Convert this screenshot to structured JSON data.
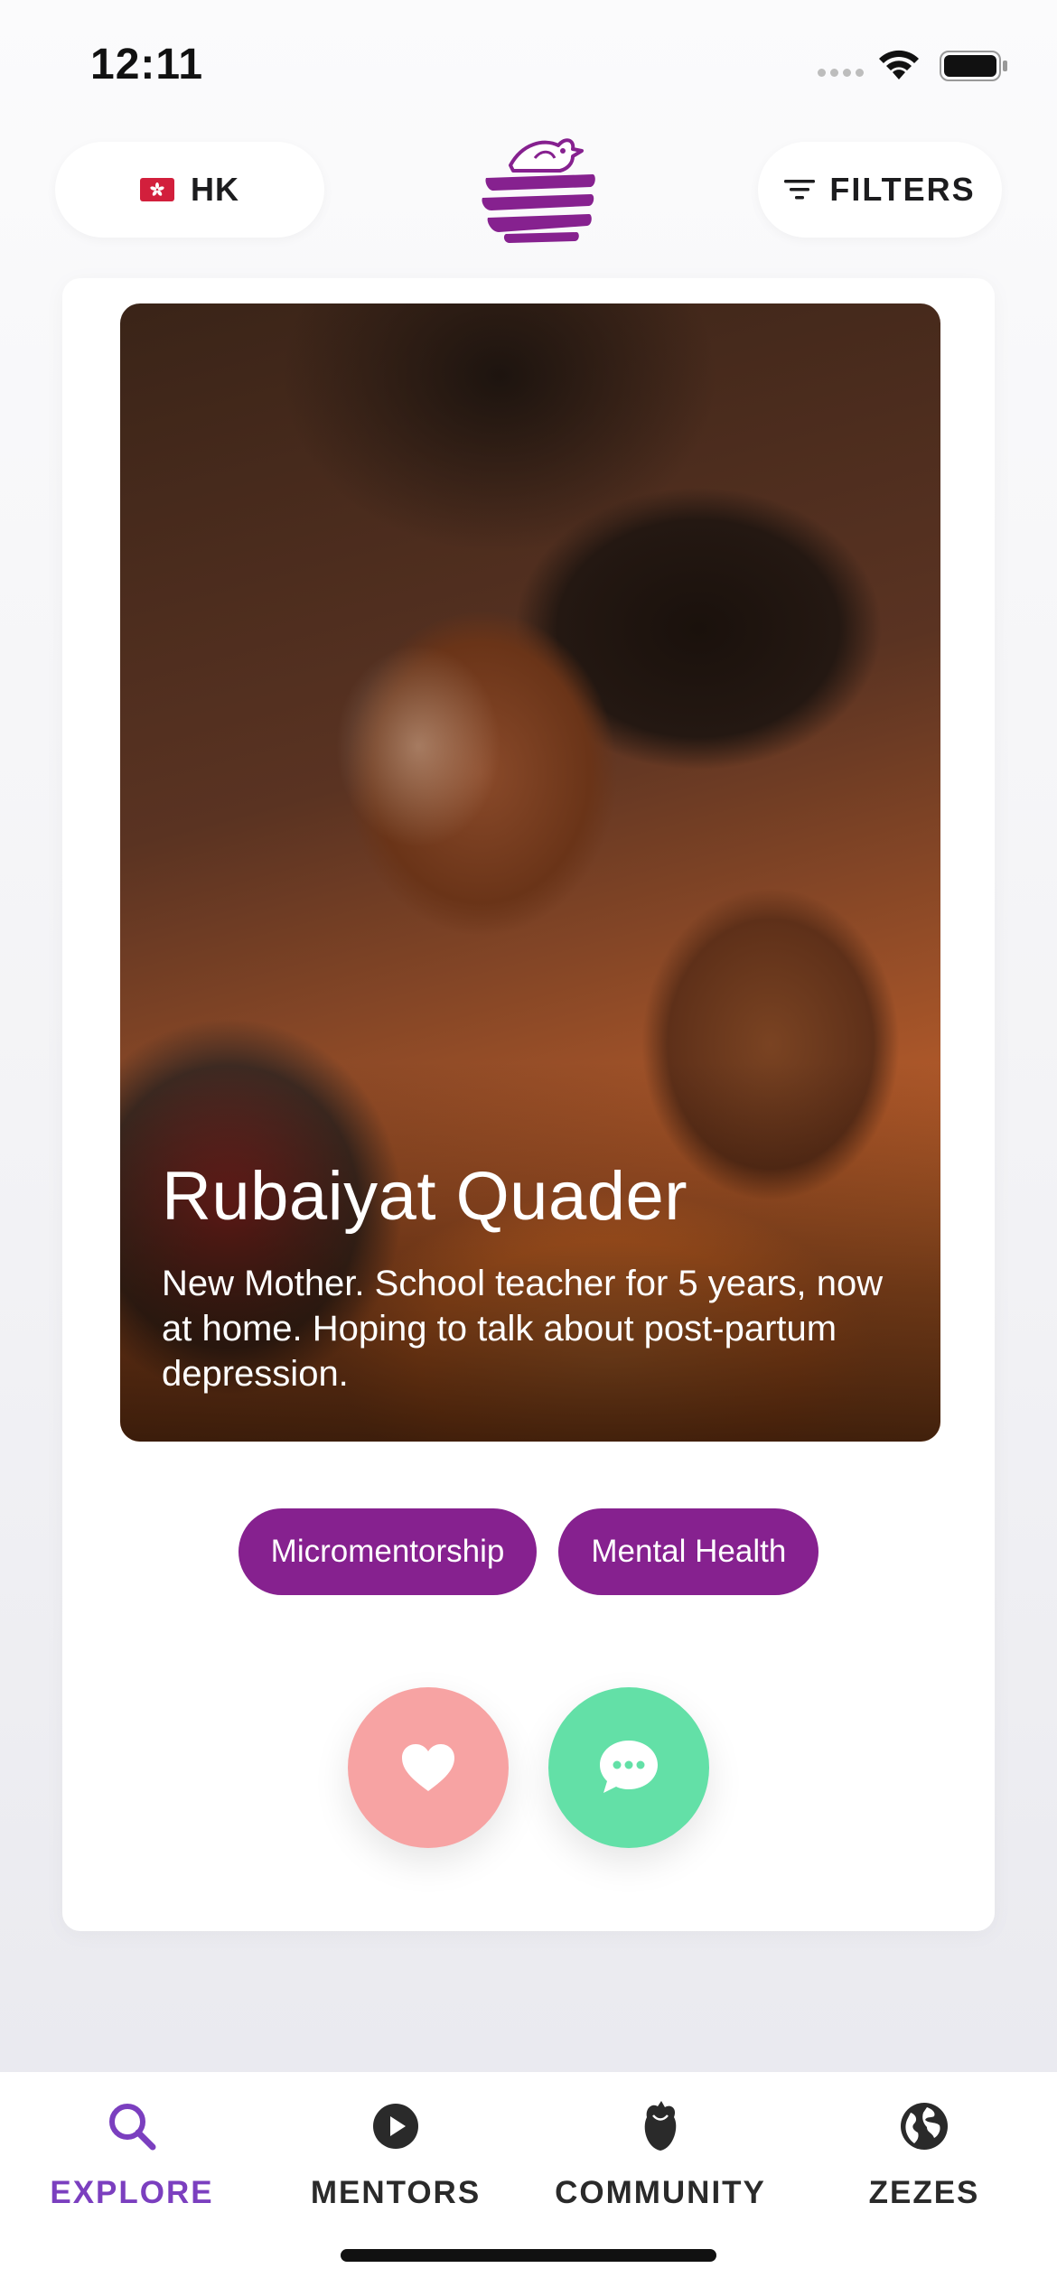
{
  "status_bar": {
    "time": "12:11"
  },
  "header": {
    "region": {
      "code": "HK",
      "flag_icon": "hong-kong-flag-icon"
    },
    "logo_icon": "bird-nest-logo-icon",
    "filters_label": "FILTERS",
    "filters_icon": "filter-lines-icon"
  },
  "profile": {
    "name": "Rubaiyat Quader",
    "bio": "New Mother. School teacher for 5 years, now at home. Hoping to talk about post-partum depression.",
    "tags": [
      "Micromentorship",
      "Mental Health"
    ],
    "actions": {
      "like_icon": "heart-icon",
      "message_icon": "chat-bubble-icon"
    }
  },
  "tab_bar": {
    "tabs": [
      {
        "label": "EXPLORE",
        "icon": "search-icon",
        "active": true
      },
      {
        "label": "MENTORS",
        "icon": "play-circle-icon",
        "active": false
      },
      {
        "label": "COMMUNITY",
        "icon": "rose-icon",
        "active": false
      },
      {
        "label": "ZEZES",
        "icon": "globe-icon",
        "active": false
      }
    ]
  },
  "colors": {
    "brand_purple": "#86218f",
    "active_tab": "#7b3fbf",
    "like": "#f7a3a3",
    "message": "#63e0a7"
  }
}
